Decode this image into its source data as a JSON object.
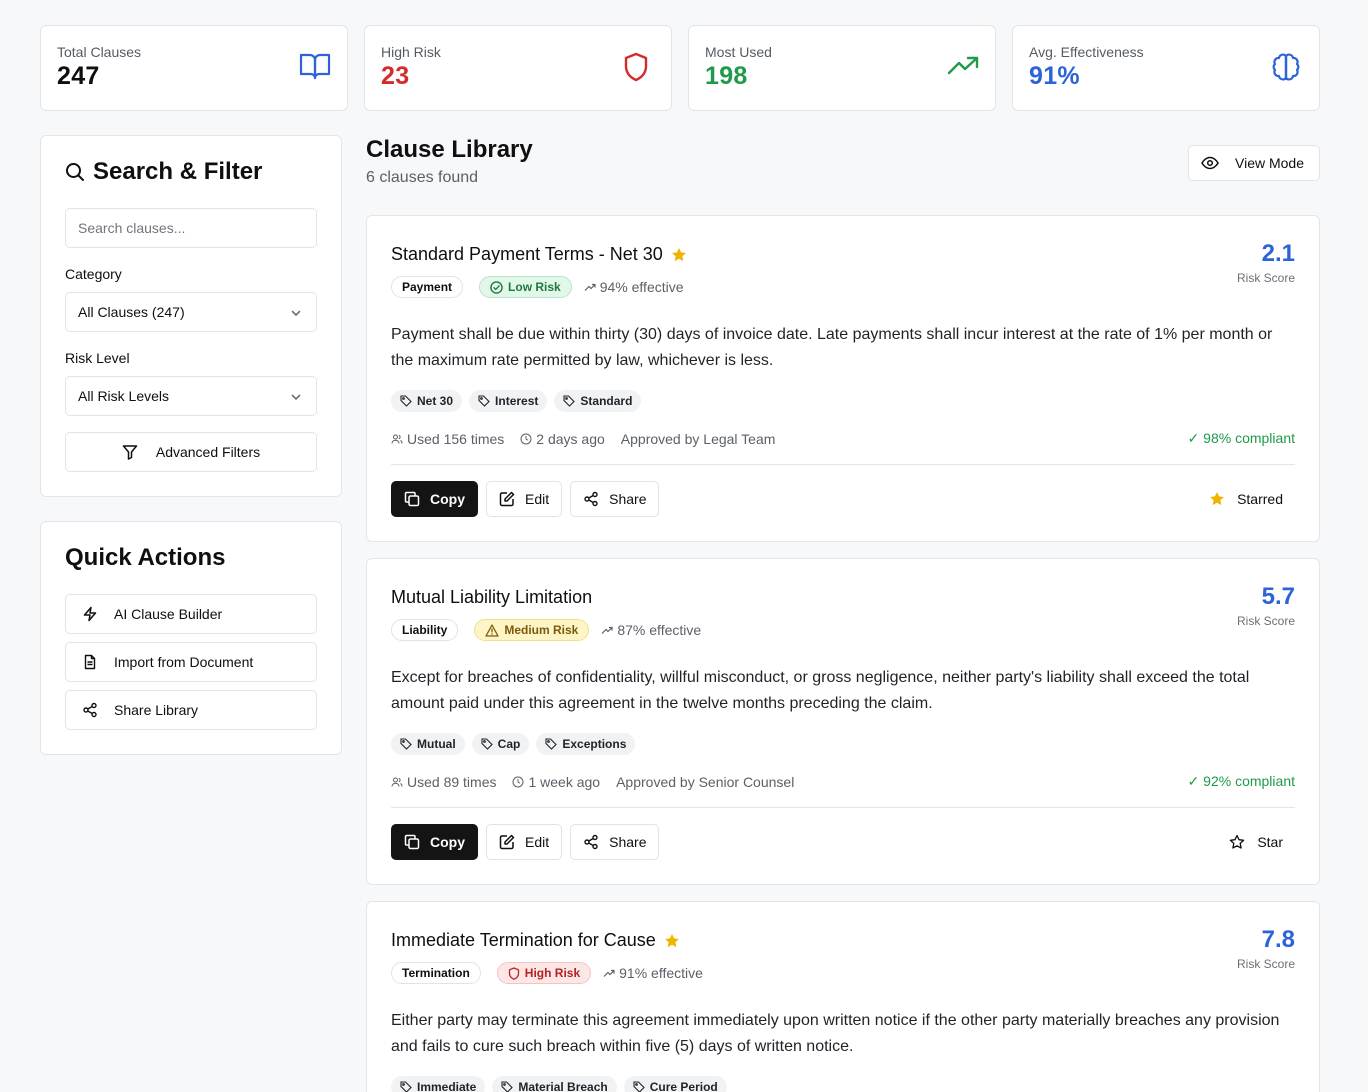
{
  "stats": [
    {
      "label": "Total Clauses",
      "value": "247",
      "color": "#0f0f10",
      "icon": "book-open-icon"
    },
    {
      "label": "High Risk",
      "value": "23",
      "color": "#d42a2a",
      "icon": "shield-icon"
    },
    {
      "label": "Most Used",
      "value": "198",
      "color": "#1f9a4b",
      "icon": "trending-up-icon"
    },
    {
      "label": "Avg. Effectiveness",
      "value": "91%",
      "color": "#2d63d9",
      "icon": "brain-icon"
    }
  ],
  "search_panel": {
    "title": "Search & Filter",
    "search_placeholder": "Search clauses...",
    "category_label": "Category",
    "category_value": "All Clauses (247)",
    "risk_label": "Risk Level",
    "risk_value": "All Risk Levels",
    "advanced_label": "Advanced Filters"
  },
  "quick_actions": {
    "title": "Quick Actions",
    "items": [
      "AI Clause Builder",
      "Import from Document",
      "Share Library"
    ]
  },
  "library": {
    "title": "Clause Library",
    "count": "6 clauses found",
    "view_mode": "View Mode"
  },
  "clauses": [
    {
      "title": "Standard Payment Terms - Net 30",
      "starred": true,
      "category": "Payment",
      "risk": "Low Risk",
      "risk_level": "low",
      "effectiveness": "94% effective",
      "score": "2.1",
      "score_label": "Risk Score",
      "text": "Payment shall be due within thirty (30) days of invoice date. Late payments shall incur interest at the rate of 1% per month or the maximum rate permitted by law, whichever is less.",
      "tags": [
        "Net 30",
        "Interest",
        "Standard"
      ],
      "used": "Used 156 times",
      "when": "2 days ago",
      "approved": "Approved by Legal Team",
      "compliance": "✓ 98% compliant",
      "star_label": "Starred"
    },
    {
      "title": "Mutual Liability Limitation",
      "starred": false,
      "category": "Liability",
      "risk": "Medium Risk",
      "risk_level": "medium",
      "effectiveness": "87% effective",
      "score": "5.7",
      "score_label": "Risk Score",
      "text": "Except for breaches of confidentiality, willful misconduct, or gross negligence, neither party's liability shall exceed the total amount paid under this agreement in the twelve months preceding the claim.",
      "tags": [
        "Mutual",
        "Cap",
        "Exceptions"
      ],
      "used": "Used 89 times",
      "when": "1 week ago",
      "approved": "Approved by Senior Counsel",
      "compliance": "✓ 92% compliant",
      "star_label": "Star"
    },
    {
      "title": "Immediate Termination for Cause",
      "starred": true,
      "category": "Termination",
      "risk": "High Risk",
      "risk_level": "high",
      "effectiveness": "91% effective",
      "score": "7.8",
      "score_label": "Risk Score",
      "text": "Either party may terminate this agreement immediately upon written notice if the other party materially breaches any provision and fails to cure such breach within five (5) days of written notice.",
      "tags": [
        "Immediate",
        "Material Breach",
        "Cure Period"
      ]
    }
  ],
  "action_labels": {
    "copy": "Copy",
    "edit": "Edit",
    "share": "Share"
  }
}
